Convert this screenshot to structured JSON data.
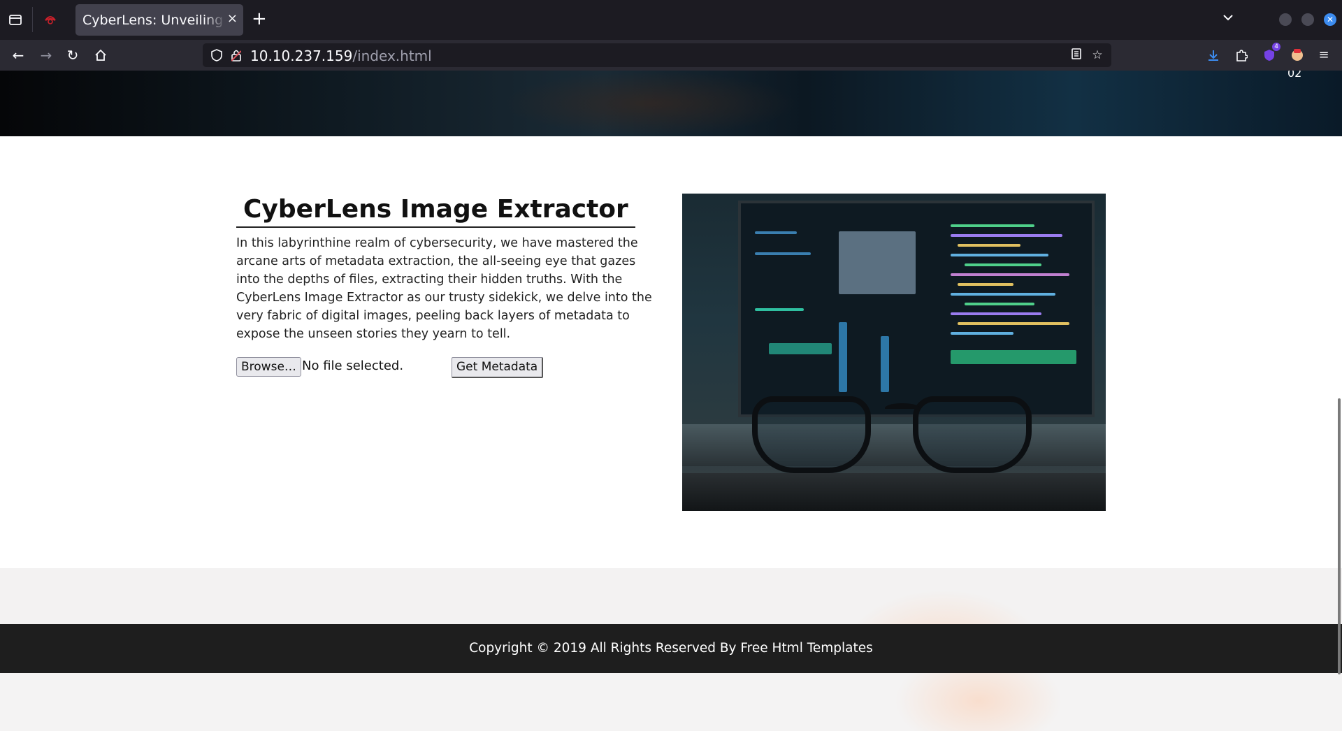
{
  "browser": {
    "tab_title": "CyberLens: Unveiling the Hidden Matrix",
    "tab_close": "×",
    "new_tab": "+",
    "url_host": "10.10.237.159",
    "url_path": "/index.html",
    "extension_badge": "4"
  },
  "hero": {
    "slide_number": "02"
  },
  "main": {
    "title": "CyberLens Image Extractor",
    "description": "In this labyrinthine realm of cybersecurity, we have mastered the arcane arts of metadata extraction, the all-seeing eye that gazes into the depths of files, extracting their hidden truths. With the CyberLens Image Extractor as our trusty sidekick, we delve into the very fabric of digital images, peeling back layers of metadata to expose the unseen stories they yearn to tell.",
    "browse_label": "Browse…",
    "file_status": "No file selected.",
    "submit_label": "Get Metadata"
  },
  "footer": {
    "copyright": "Copyright © 2019 All Rights Reserved By Free Html Templates"
  },
  "icons": {
    "firefox_view": "firefox-view-icon",
    "back": "back-arrow-icon",
    "forward": "forward-arrow-icon",
    "reload": "reload-icon",
    "home": "home-icon",
    "shield": "tracking-shield-icon",
    "lock": "insecure-lock-icon",
    "reader": "reader-view-icon",
    "bookmark": "bookmark-star-icon",
    "download": "download-icon",
    "extensions": "extensions-puzzle-icon",
    "menu": "hamburger-menu-icon"
  },
  "colors": {
    "chrome_dark": "#1c1b22",
    "toolbar": "#2b2a33",
    "footer_bg": "#1e1e1e",
    "accent_blue": "#3c8cf0"
  }
}
